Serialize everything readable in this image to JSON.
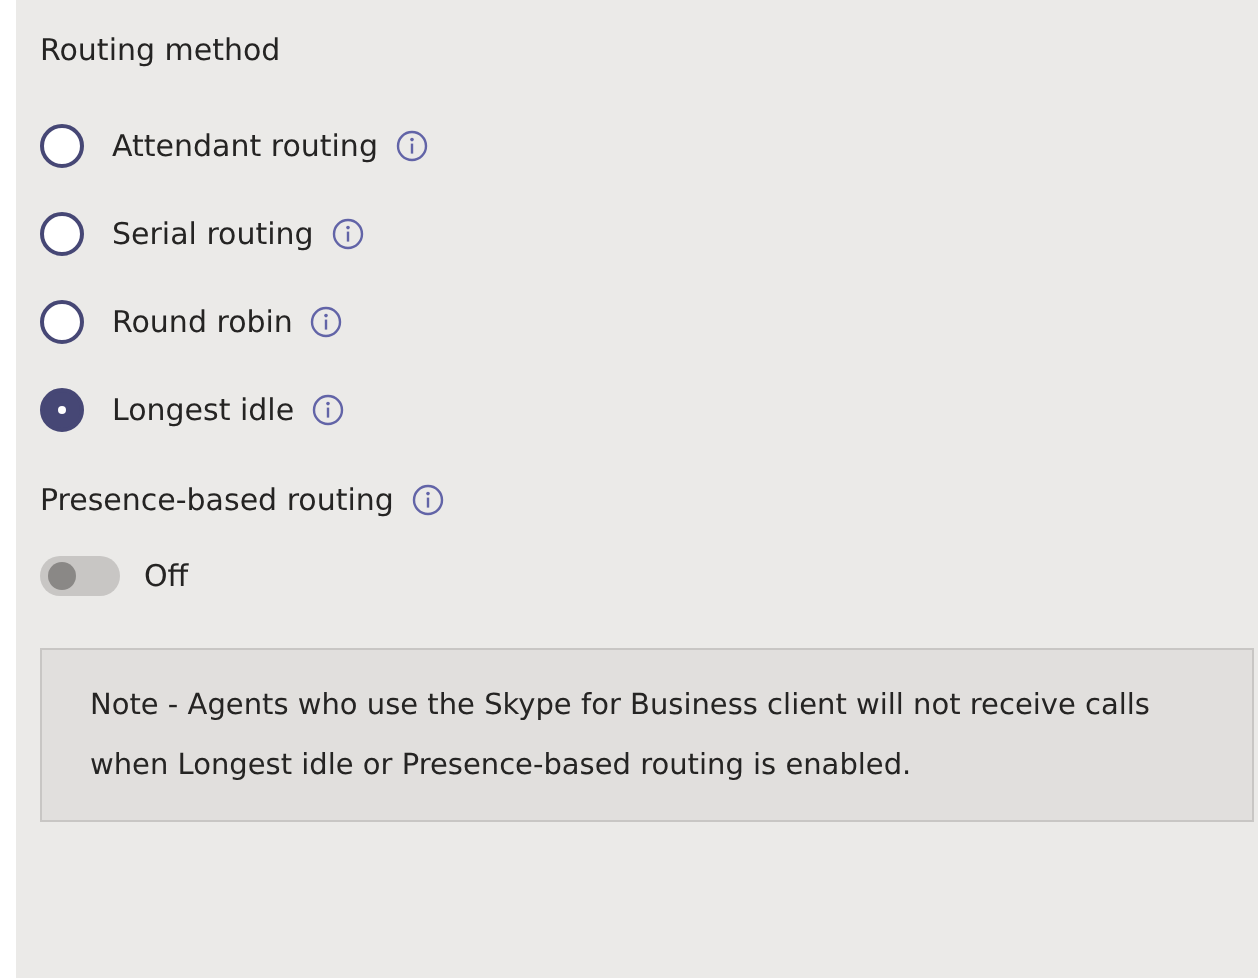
{
  "routing_method": {
    "title": "Routing method",
    "options": [
      {
        "label": "Attendant routing",
        "selected": false
      },
      {
        "label": "Serial routing",
        "selected": false
      },
      {
        "label": "Round robin",
        "selected": false
      },
      {
        "label": "Longest idle",
        "selected": true
      }
    ]
  },
  "presence": {
    "label": "Presence-based routing",
    "on": false,
    "state_text": "Off"
  },
  "note": "Note - Agents who use the Skype for Business client will not receive calls when Longest idle or Presence-based routing is enabled."
}
